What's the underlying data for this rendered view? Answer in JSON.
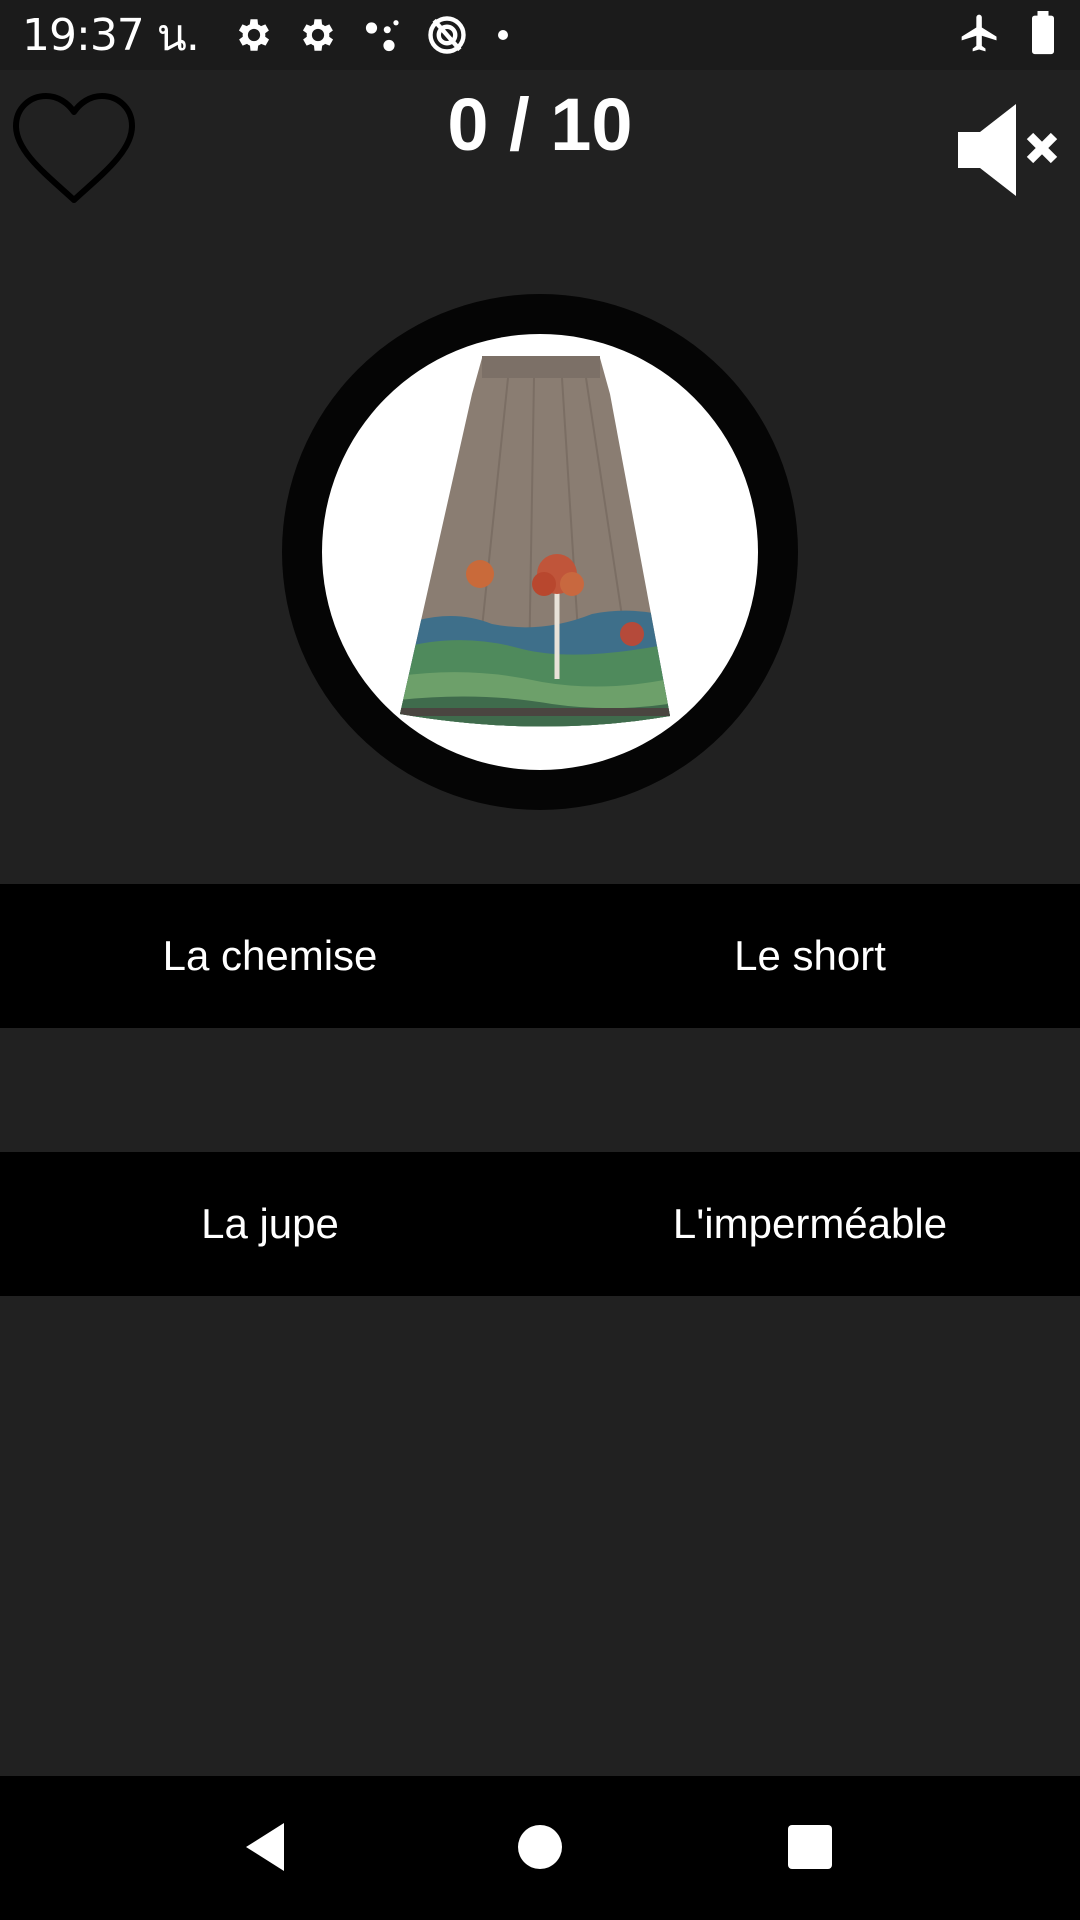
{
  "status_bar": {
    "time": "19:37 น.",
    "icons_left": [
      "settings-gear-icon",
      "settings-gear-icon",
      "assistant-dots-icon",
      "data-saver-icon",
      "notification-dot-icon"
    ],
    "icons_right": [
      "airplane-mode-icon",
      "battery-icon"
    ]
  },
  "header": {
    "score": "0 / 10",
    "favorite_icon": "heart-outline-icon",
    "sound_icon": "volume-muted-icon"
  },
  "question": {
    "image": "skirt-picture"
  },
  "answers": {
    "row1": [
      "La chemise",
      "Le short"
    ],
    "row2": [
      "La jupe",
      "L'imperméable"
    ]
  },
  "nav_bar": {
    "icons": [
      "back-icon",
      "home-icon",
      "recents-icon"
    ]
  },
  "colors": {
    "background": "#212121",
    "answer_background": "#000000",
    "text": "#ffffff",
    "skirt": "#8a7d72"
  }
}
